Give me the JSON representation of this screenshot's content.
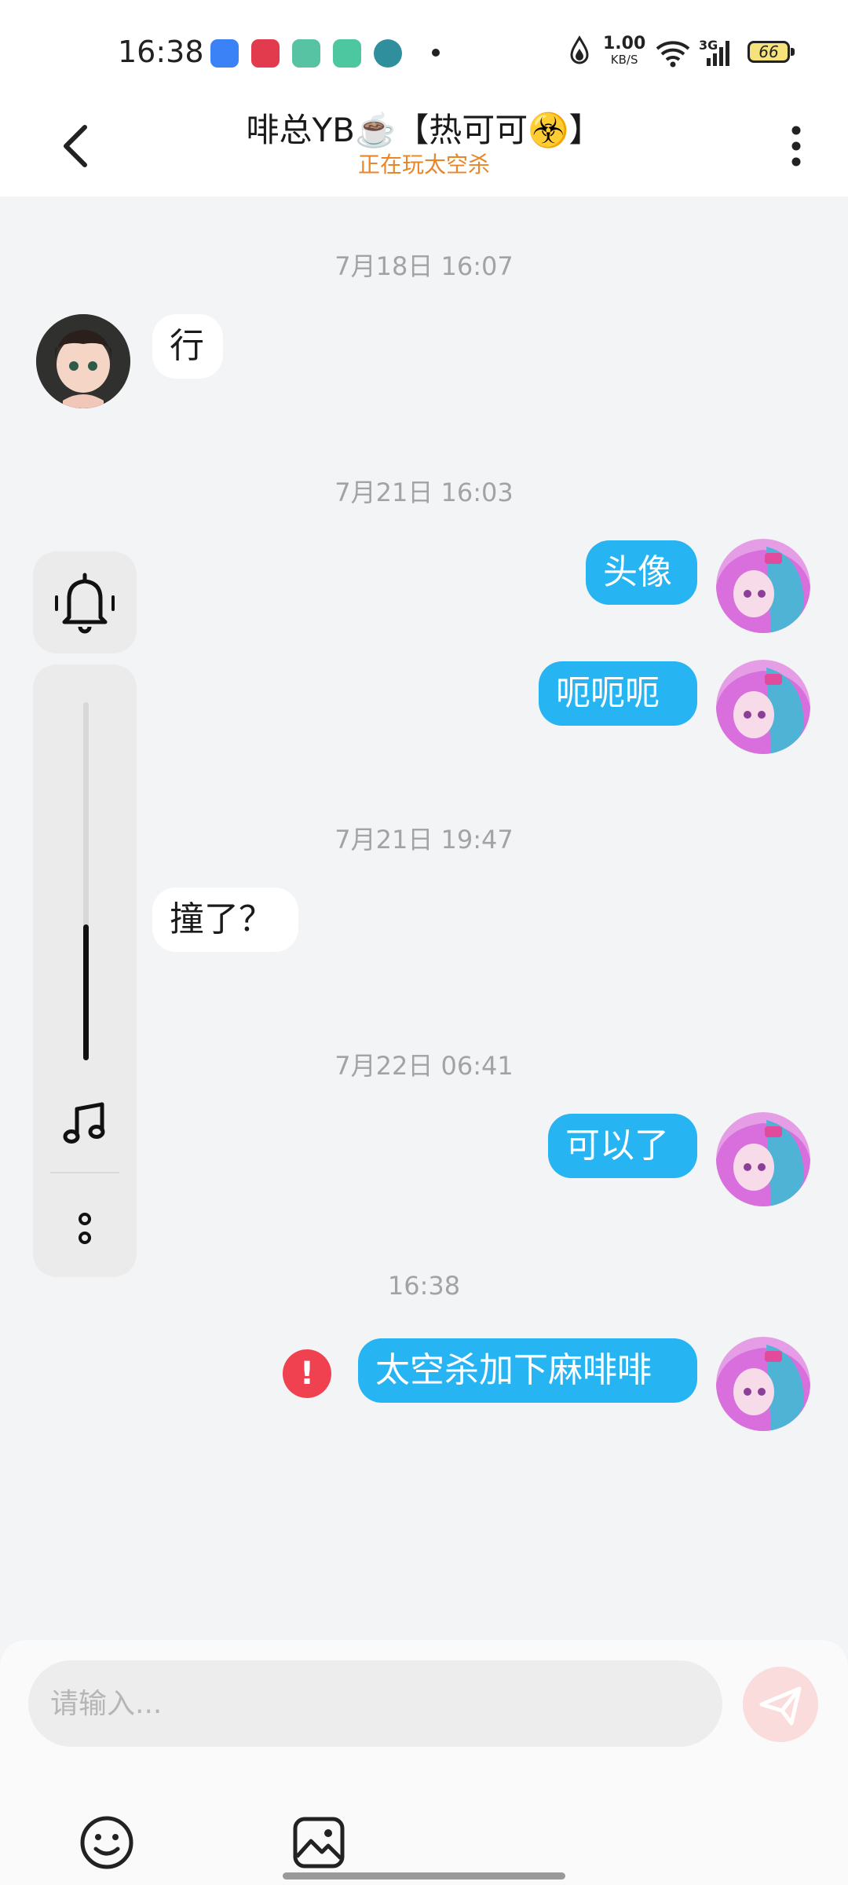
{
  "status_bar": {
    "time": "16:38",
    "net_speed_value": "1.00",
    "net_speed_unit": "KB/S",
    "network_type": "3G",
    "battery_level": "66",
    "icons": [
      "app-blue-icon",
      "video-icon",
      "app-green-icon",
      "phone-icon",
      "globe-icon",
      "notification-dot",
      "drop-icon",
      "wifi-icon",
      "signal-icon",
      "battery-icon"
    ]
  },
  "header": {
    "title": "啡总YB☕️【热可可☣️】",
    "subtitle": "正在玩太空杀"
  },
  "messages": [
    {
      "type": "timestamp",
      "text": "7月18日 16:07"
    },
    {
      "type": "incoming",
      "text": "行"
    },
    {
      "type": "timestamp",
      "text": "7月21日 16:03"
    },
    {
      "type": "outgoing",
      "text": "头像"
    },
    {
      "type": "outgoing",
      "text": "呃呃呃"
    },
    {
      "type": "timestamp",
      "text": "7月21日 19:47"
    },
    {
      "type": "incoming",
      "text": "撞了？"
    },
    {
      "type": "timestamp",
      "text": "7月22日 06:41"
    },
    {
      "type": "outgoing",
      "text": "可以了"
    },
    {
      "type": "timestamp",
      "text": "16:38"
    },
    {
      "type": "outgoing",
      "text": "太空杀加下麻啡啡",
      "status": "failed"
    }
  ],
  "side_panel": {
    "volume_level": 0.38,
    "icons": [
      "bell-icon",
      "music-note-icon",
      "more-dots-icon"
    ]
  },
  "input": {
    "placeholder": "请输入..."
  },
  "colors": {
    "outgoing_bubble": "#27b4f2",
    "incoming_bubble": "#ffffff",
    "subtitle": "#e8862a",
    "error": "#ef4150",
    "send_button": "#fbdcdc"
  }
}
